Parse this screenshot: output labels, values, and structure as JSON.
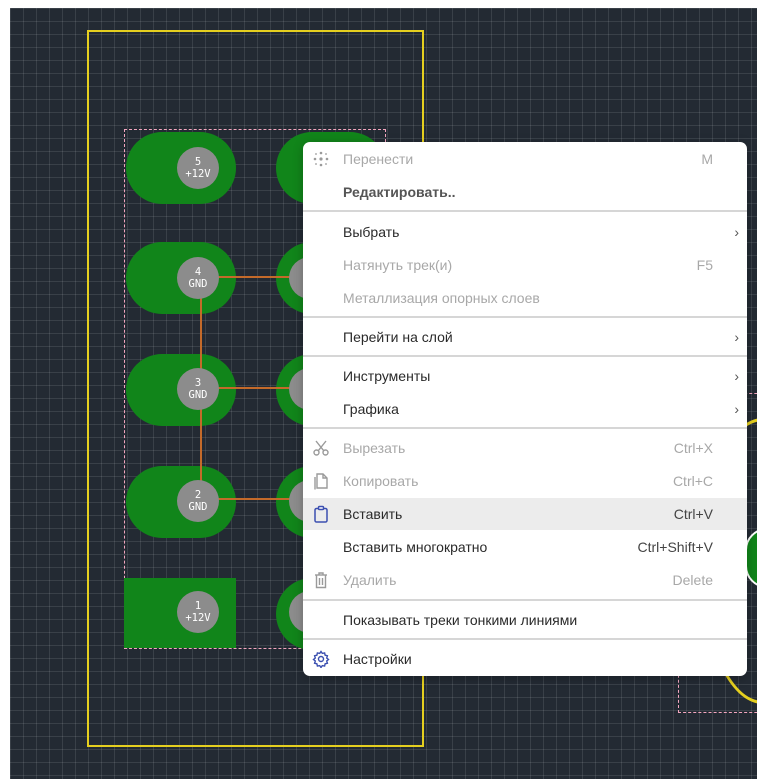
{
  "menu": {
    "items": [
      {
        "label": "Перенести",
        "shortcut": "M",
        "icon": "move-icon",
        "disabled": true
      },
      {
        "label": "Редактировать..",
        "shortcut": "",
        "bold": true
      },
      {
        "label": "Выбрать",
        "submenu": true
      },
      {
        "label": "Натянуть трек(и)",
        "shortcut": "F5",
        "disabled": true
      },
      {
        "label": "Металлизация опорных слоев",
        "disabled": true
      },
      {
        "label": "Перейти на слой",
        "submenu": true
      },
      {
        "label": "Инструменты",
        "submenu": true
      },
      {
        "label": "Графика",
        "submenu": true
      },
      {
        "label": "Вырезать",
        "shortcut": "Ctrl+X",
        "icon": "scissors-icon",
        "disabled": true
      },
      {
        "label": "Копировать",
        "shortcut": "Ctrl+C",
        "icon": "copy-icon",
        "disabled": true
      },
      {
        "label": "Вставить",
        "shortcut": "Ctrl+V",
        "icon": "clipboard-icon",
        "highlighted": true
      },
      {
        "label": "Вставить многократно",
        "shortcut": "Ctrl+Shift+V"
      },
      {
        "label": "Удалить",
        "shortcut": "Delete",
        "icon": "trash-icon",
        "disabled": true
      },
      {
        "label": "Показывать треки тонкими линиями"
      },
      {
        "label": "Настройки",
        "icon": "gear-icon"
      }
    ],
    "submenu_arrow": "›"
  },
  "pads": [
    {
      "number": "5",
      "net": "+12V"
    },
    {
      "number": "4",
      "net": "GND"
    },
    {
      "number": "3",
      "net": "GND"
    },
    {
      "number": "2",
      "net": "GND"
    },
    {
      "number": "1",
      "net": "+12V"
    }
  ],
  "colors": {
    "canvas": "#232a33",
    "board_outline": "#e5cf1f",
    "pad": "#11851a",
    "selection": "#f3a6bf",
    "trace": "#c46a2a",
    "menu_highlight": "#ececec",
    "icon_accent": "#3b4fb0"
  }
}
